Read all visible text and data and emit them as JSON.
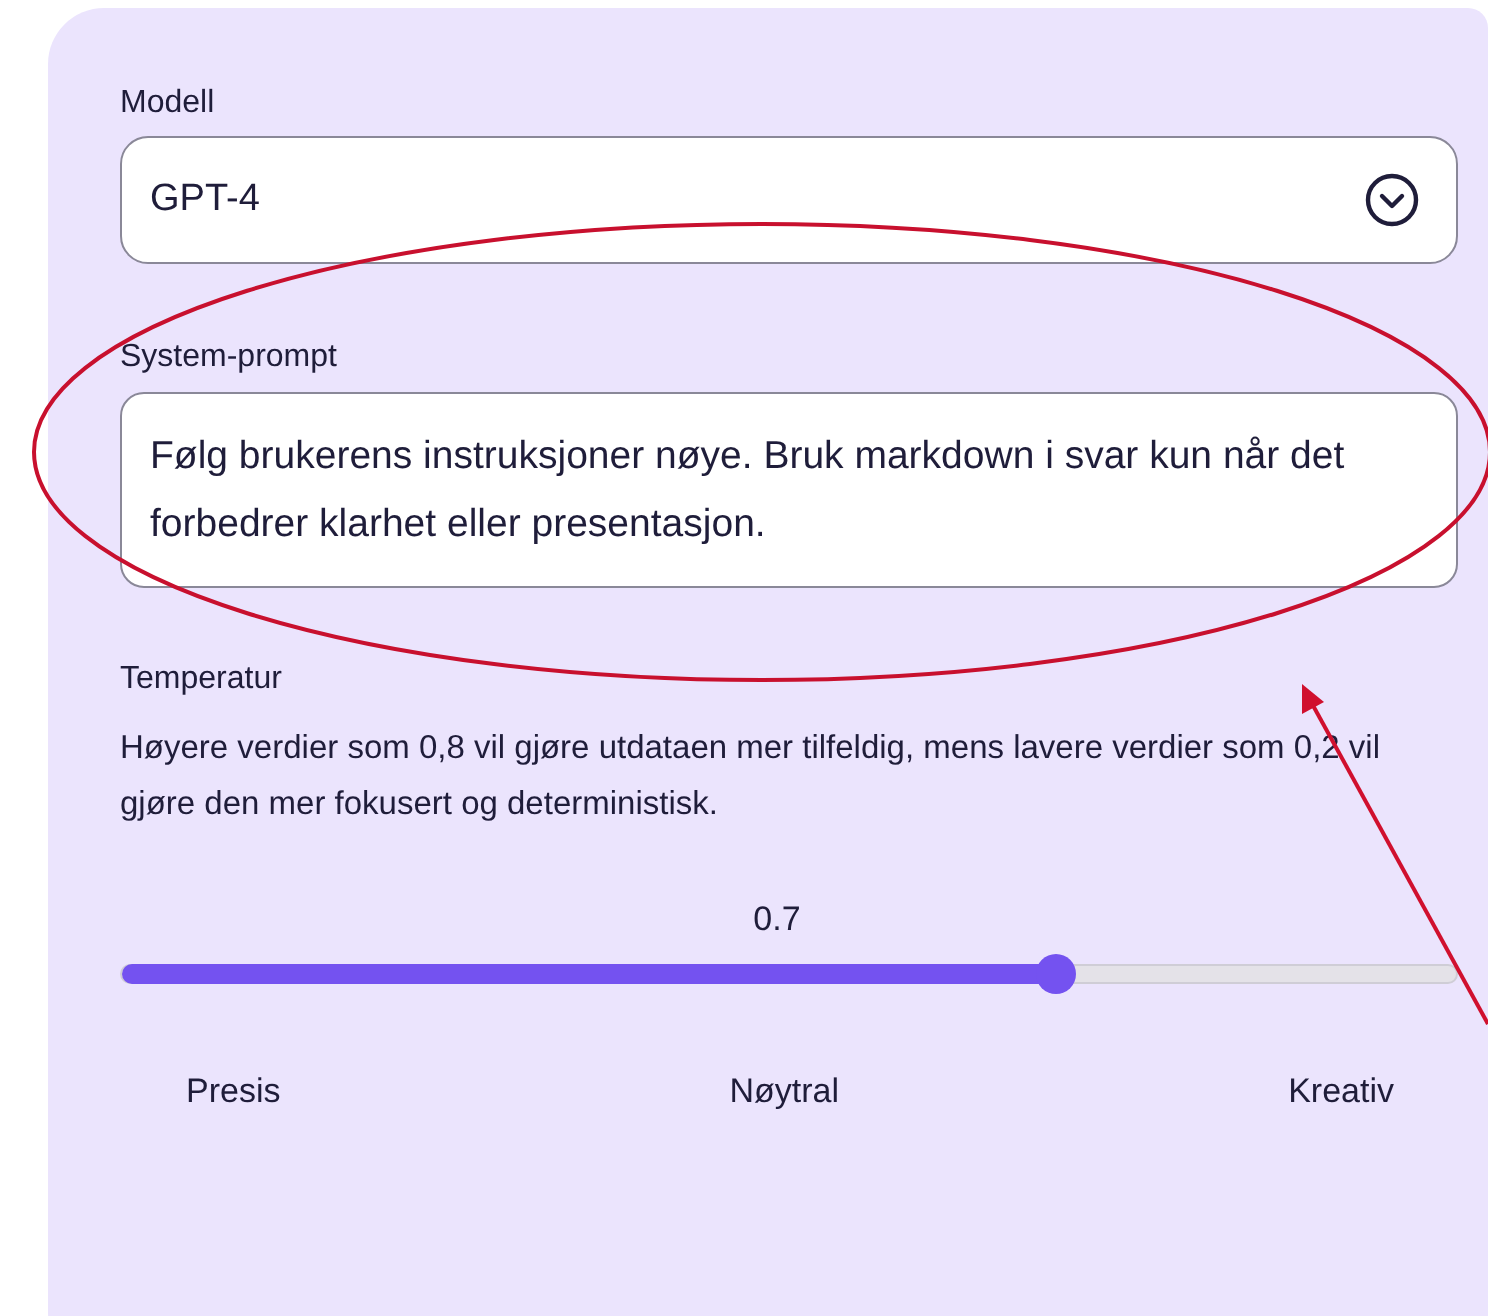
{
  "model": {
    "label": "Modell",
    "value": "GPT-4"
  },
  "system_prompt": {
    "label": "System-prompt",
    "value": "Følg brukerens instruksjoner nøye. Bruk markdown i svar kun når det forbedrer klarhet eller presentasjon."
  },
  "temperature": {
    "label": "Temperatur",
    "description": "Høyere verdier som 0,8 vil gjøre utdataen mer tilfeldig, mens lavere verdier som 0,2 vil gjøre den mer fokusert og deterministisk.",
    "reading": "0.7",
    "level": 0.7,
    "scale_labels": [
      "Presis",
      "Nøytral",
      "Kreativ"
    ]
  }
}
